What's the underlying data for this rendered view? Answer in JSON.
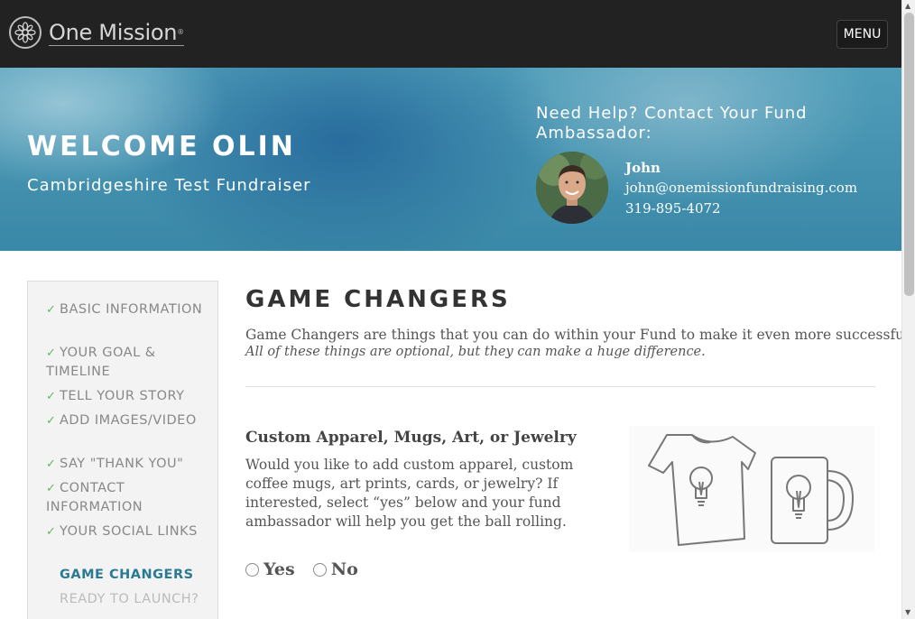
{
  "header": {
    "brand": "One Mission",
    "brand_tm": "®",
    "menu_label": "MENU"
  },
  "hero": {
    "welcome": "WELCOME OLIN",
    "subtitle": "Cambridgeshire Test Fundraiser",
    "help_title": "Need Help? Contact Your Fund Ambassador:",
    "ambassador": {
      "name": "John",
      "email": "john@onemissionfundraising.com",
      "phone": "319-895-4072"
    }
  },
  "sidebar": {
    "items": [
      {
        "label": "BASIC INFORMATION",
        "status": "done"
      },
      {
        "label": "YOUR GOAL & TIMELINE",
        "status": "done"
      },
      {
        "label": "TELL YOUR STORY",
        "status": "done"
      },
      {
        "label": "ADD IMAGES/VIDEO",
        "status": "done"
      },
      {
        "label": "SAY \"THANK YOU\"",
        "status": "done"
      },
      {
        "label": "CONTACT INFORMATION",
        "status": "done"
      },
      {
        "label": "YOUR SOCIAL LINKS",
        "status": "done"
      },
      {
        "label": "GAME CHANGERS",
        "status": "active"
      },
      {
        "label": "READY TO LAUNCH?",
        "status": "pending"
      }
    ],
    "check_glyph": "✓"
  },
  "main": {
    "title": "GAME CHANGERS",
    "intro": "Game Changers are things that you can do within your Fund to make it even more successful.",
    "intro_emphasis": "All of these things are optional, but they can make a huge difference.",
    "section": {
      "title": "Custom Apparel, Mugs, Art, or Jewelry",
      "description": "Would you like to add custom apparel, custom coffee mugs, art prints, cards, or jewelry? If interested, select “yes” below and your fund ambassador will help you get the ball rolling.",
      "illustration": [
        "tshirt-lightbulb-icon",
        "mug-lightbulb-icon"
      ],
      "options": [
        {
          "label": "Yes",
          "selected": false
        },
        {
          "label": "No",
          "selected": false
        }
      ]
    }
  },
  "colors": {
    "topbar": "#222222",
    "hero": "#3a88a7",
    "active_nav": "#2a7a93",
    "check": "#5cb85c"
  }
}
